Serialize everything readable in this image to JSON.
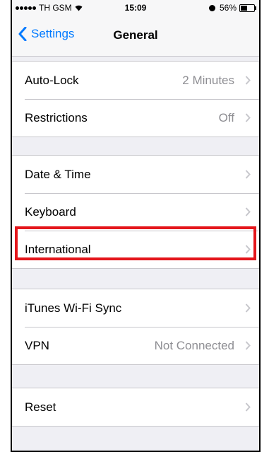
{
  "status_bar": {
    "carrier": "TH GSM",
    "time": "15:09",
    "battery_percent": "56%",
    "battery_level": 0.56
  },
  "nav": {
    "back_label": "Settings",
    "title": "General"
  },
  "groups": [
    {
      "rows": [
        {
          "label": "Auto-Lock",
          "value": "2 Minutes"
        },
        {
          "label": "Restrictions",
          "value": "Off"
        }
      ]
    },
    {
      "rows": [
        {
          "label": "Date & Time",
          "value": ""
        },
        {
          "label": "Keyboard",
          "value": ""
        },
        {
          "label": "International",
          "value": ""
        }
      ]
    },
    {
      "rows": [
        {
          "label": "iTunes Wi-Fi Sync",
          "value": ""
        },
        {
          "label": "VPN",
          "value": "Not Connected"
        }
      ]
    },
    {
      "rows": [
        {
          "label": "Reset",
          "value": ""
        }
      ]
    }
  ],
  "colors": {
    "accent": "#007aff",
    "highlight": "#e4161b"
  }
}
